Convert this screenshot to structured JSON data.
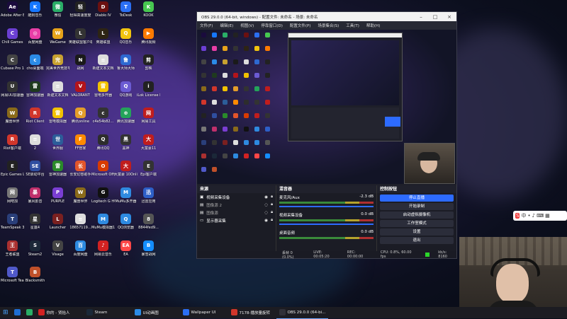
{
  "desktop_icons": [
    {
      "label": "Adobe After Effects 表...",
      "color": "#1a0b3d",
      "glyph": "Ae"
    },
    {
      "label": "酷狗音乐",
      "color": "#1677ff",
      "glyph": "K"
    },
    {
      "label": "微信",
      "color": "#2aae67",
      "glyph": "微"
    },
    {
      "label": "轻得高速度度",
      "color": "#222",
      "glyph": "轻"
    },
    {
      "label": "Diablo IV",
      "color": "#6b1010",
      "glyph": "D"
    },
    {
      "label": "ToDesk",
      "color": "#2b6ff3",
      "glyph": "T"
    },
    {
      "label": "KOOK",
      "color": "#47c750",
      "glyph": "K"
    },
    {
      "label": "Chill Games",
      "color": "#6b3fd3",
      "glyph": "C"
    },
    {
      "label": "百度网盘",
      "color": "#e83ea7",
      "glyph": "◎"
    },
    {
      "label": "WeGame",
      "color": "#e7a31a",
      "glyph": "W"
    },
    {
      "label": "英雄联盟客户端",
      "color": "#333",
      "glyph": "L"
    },
    {
      "label": "英雄联盟",
      "color": "#2d2414",
      "glyph": "L"
    },
    {
      "label": "QQ音乐",
      "color": "#f1c40f",
      "glyph": "Q"
    },
    {
      "label": "腾讯视频",
      "color": "#ff7a00",
      "glyph": "▶"
    },
    {
      "label": "Cubase Pro 12",
      "color": "#444",
      "glyph": "C"
    },
    {
      "label": "cho桌面端",
      "color": "#2b8be6",
      "glyph": "c"
    },
    {
      "label": "完美世界竞技平台",
      "color": "#c8a230",
      "glyph": "完"
    },
    {
      "label": "战网",
      "color": "#1a1a1a",
      "glyph": "N"
    },
    {
      "label": "新建文本文档",
      "color": "#ddd",
      "glyph": "≡"
    },
    {
      "label": "鲁大师大师",
      "color": "#2e69d1",
      "glyph": "鲁"
    },
    {
      "label": "剪映",
      "color": "#222",
      "glyph": "剪"
    },
    {
      "label": "网易UU加速器",
      "color": "#333",
      "glyph": "U"
    },
    {
      "label": "雷神加速器",
      "color": "#1f3a1f",
      "glyph": "雷"
    },
    {
      "label": "新建文本文档",
      "color": "#ddd",
      "glyph": "≡"
    },
    {
      "label": "VALORANT",
      "color": "#b3141b",
      "glyph": "V"
    },
    {
      "label": "雷电多开器",
      "color": "#f2c200",
      "glyph": "雷"
    },
    {
      "label": "QQ游戏",
      "color": "#6b5bd3",
      "glyph": "Q"
    },
    {
      "label": "iLok License Manager",
      "color": "#222",
      "glyph": "i"
    },
    {
      "label": "魔兽世界",
      "color": "#8a6a1a",
      "glyph": "W"
    },
    {
      "label": "Riot Client",
      "color": "#d1362b",
      "glyph": "R"
    },
    {
      "label": "雷电模拟器",
      "color": "#f2c200",
      "glyph": "雷"
    },
    {
      "label": "腾讯online",
      "color": "#e39d2a",
      "glyph": "Q"
    },
    {
      "label": "c4e54b82...",
      "color": "#333",
      "glyph": "c"
    },
    {
      "label": "腾讯加速器",
      "color": "#24a35a",
      "glyph": "⊕"
    },
    {
      "label": "网易工具",
      "color": "#c01d1d",
      "glyph": "网"
    },
    {
      "label": "Riot客户端",
      "color": "#d1362b",
      "glyph": "R"
    },
    {
      "label": "2",
      "color": "#ddd",
      "glyph": "≡"
    },
    {
      "label": "世界服",
      "color": "#2c5d99",
      "glyph": "世"
    },
    {
      "label": "FF管家",
      "color": "#ff8a00",
      "glyph": "F"
    },
    {
      "label": "腾讯QQ",
      "color": "#2d2d2d",
      "glyph": "Q"
    },
    {
      "label": "黑神",
      "color": "#333",
      "glyph": "黑"
    },
    {
      "label": "大富豪11",
      "color": "#c01d1d",
      "glyph": "大"
    },
    {
      "label": "Epic Games Launcher",
      "color": "#222",
      "glyph": "E"
    },
    {
      "label": "SE启动平台",
      "color": "#2f4ea0",
      "glyph": "SE"
    },
    {
      "label": "雷神加速器",
      "color": "#2a8a2a",
      "glyph": "雷"
    },
    {
      "label": "长安幻想助手",
      "color": "#e2552b",
      "glyph": "长"
    },
    {
      "label": "Microsoft Office 家...",
      "color": "#d83b01",
      "glyph": "O"
    },
    {
      "label": "大富豪 10Online...",
      "color": "#c01d1d",
      "glyph": "大"
    },
    {
      "label": "Epi客户端",
      "color": "#333",
      "glyph": "E"
    },
    {
      "label": "网吧加",
      "color": "#777",
      "glyph": "网"
    },
    {
      "label": "暴风影音",
      "color": "#c0306b",
      "glyph": "暴"
    },
    {
      "label": "PURPLE",
      "color": "#7a3ed3",
      "glyph": "P"
    },
    {
      "label": "魔兽世界",
      "color": "#8a6a1a",
      "glyph": "W"
    },
    {
      "label": "Logitech G HUB",
      "color": "#111",
      "glyph": "G"
    },
    {
      "label": "MuMu多开器",
      "color": "#2f8ae0",
      "glyph": "M"
    },
    {
      "label": "迅雷应用",
      "color": "#2d5fc7",
      "glyph": "迅"
    },
    {
      "label": "TeamSpeak 3",
      "color": "#2a3f7a",
      "glyph": "T"
    },
    {
      "label": "星露4",
      "color": "#333",
      "glyph": "星"
    },
    {
      "label": "Launcher",
      "color": "#7a2020",
      "glyph": "L"
    },
    {
      "label": "18657119...",
      "color": "#ddd",
      "glyph": "≡"
    },
    {
      "label": "MuMu模拟器12",
      "color": "#2f8ae0",
      "glyph": "M"
    },
    {
      "label": "QQ浏览器",
      "color": "#2d8ae0",
      "glyph": "Q"
    },
    {
      "label": "8844fed9...",
      "color": "#555",
      "glyph": "8"
    },
    {
      "label": "王者联盟",
      "color": "#aa3030",
      "glyph": "王"
    },
    {
      "label": "Steam2",
      "color": "#1b2838",
      "glyph": "S"
    },
    {
      "label": "Visage",
      "color": "#444",
      "glyph": "V"
    },
    {
      "label": "百度网盘",
      "color": "#2d8ae0",
      "glyph": "百"
    },
    {
      "label": "网易云音乐",
      "color": "#d22222",
      "glyph": "♪"
    },
    {
      "label": "EA",
      "color": "#ff4747",
      "glyph": "EA"
    },
    {
      "label": "暴雪战网",
      "color": "#148eff",
      "glyph": "B"
    },
    {
      "label": "Microsoft Teams",
      "color": "#5059c9",
      "glyph": "T"
    },
    {
      "label": "Blacksmith",
      "color": "#c0502a",
      "glyph": "B"
    }
  ],
  "obs": {
    "title": "OBS 29.0.0 (64-bit, windows) - 配置文件: 未命名 - 场景: 未命名",
    "menu": [
      "文件(F)",
      "编辑(E)",
      "视图(V)",
      "停靠窗口(D)",
      "配置文件(P)",
      "场景集合(S)",
      "工具(T)",
      "帮助(H)"
    ],
    "docks": {
      "sources_title": "来源",
      "sources": [
        "视频采集设备",
        "图像源 2",
        "图像源",
        "显示器采集"
      ],
      "mixer_title": "混音器",
      "mixer": [
        {
          "name": "麦克风/Aux",
          "db": "-2.3 dB"
        },
        {
          "name": "视频采集设备",
          "db": "0.0 dB"
        },
        {
          "name": "桌面音频",
          "db": "0.0 dB"
        }
      ],
      "controls_title": "控制按钮",
      "controls": [
        "停止直播",
        "开始录制",
        "启动虚拟摄像机",
        "工作室模式",
        "设置",
        "退出"
      ]
    },
    "status": [
      "丢帧 0 (0.0%)",
      "LIVE: 00:05:20",
      "REC: 00:00:00",
      "CPU: 0.8%, 60.00 fps",
      "kb/s: 8160"
    ]
  },
  "taskbar": [
    {
      "label": "",
      "color": "#1f6ed4"
    },
    {
      "label": "",
      "color": "#2aae67"
    },
    {
      "label": "你的 - 贤抬人",
      "color": "#d22222"
    },
    {
      "label": "Steam",
      "color": "#1b2838"
    },
    {
      "label": "UI动画图",
      "color": "#2b8be6"
    },
    {
      "label": "Wallpaper UI",
      "color": "#2b6ff3"
    },
    {
      "label": "7178-播放量旋转",
      "color": "#d1362b"
    },
    {
      "label": "OBS 29.0.0 (64-bi...",
      "color": "#303038"
    }
  ],
  "ime": {
    "label": "中"
  }
}
